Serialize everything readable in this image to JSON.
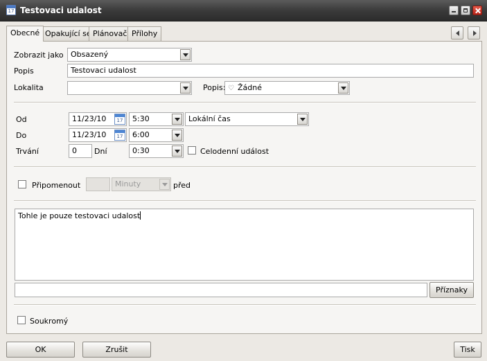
{
  "window": {
    "title": "Testovaci udalost",
    "icon_text": "17",
    "controls": {
      "minimize_icon": "minimize-icon",
      "maximize_icon": "maximize-icon",
      "close_icon": "close-icon"
    }
  },
  "tabs": [
    {
      "label": "Obecné",
      "active": true
    },
    {
      "label": "Opakující se",
      "active": false
    },
    {
      "label": "Plánovač",
      "active": false
    },
    {
      "label": "Přílohy",
      "active": false
    }
  ],
  "general": {
    "show_as_label": "Zobrazit jako",
    "show_as_value": "Obsazený",
    "description_label": "Popis",
    "description_value": "Testovaci udalost",
    "location_label": "Lokalita",
    "location_value": "",
    "category_label": "Popis:",
    "category_value": "Žádné",
    "category_icon": "heart-icon"
  },
  "time": {
    "from_label": "Od",
    "from_date": "11/23/10",
    "from_time": "5:30",
    "timezone_value": "Lokální čas",
    "to_label": "Do",
    "to_date": "11/23/10",
    "to_time": "6:00",
    "duration_label": "Trvání",
    "duration_days": "0",
    "days_label": "Dní",
    "duration_time": "0:30",
    "allday_label": "Celodenní událost",
    "allday_checked": false,
    "calendar_icon_text": "17"
  },
  "reminder": {
    "label": "Připomenout",
    "checked": false,
    "amount": "",
    "unit": "Minuty",
    "suffix": "před"
  },
  "notes": {
    "text": "Tohle je pouze testovaci udalost",
    "flags_value": "",
    "flags_button": "Příznaky"
  },
  "privacy": {
    "label": "Soukromý",
    "checked": false
  },
  "footer": {
    "ok": "OK",
    "cancel": "Zrušit",
    "print": "Tisk"
  }
}
